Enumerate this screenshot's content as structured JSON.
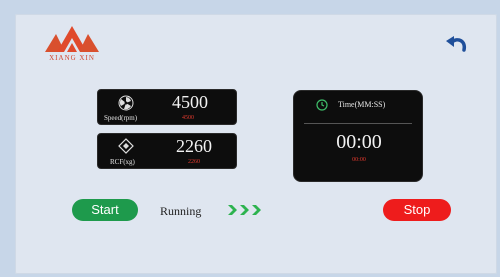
{
  "logo": {
    "brand": "XIANG XIN"
  },
  "header": {
    "back_icon": "undo-arrow-icon"
  },
  "panels": {
    "speed": {
      "label": "Speed(rpm)",
      "value": "4500",
      "setpoint": "4500",
      "icon": "fan-icon"
    },
    "rcf": {
      "label": "RCF(xg)",
      "value": "2260",
      "setpoint": "2260",
      "icon": "rcf-diamond-icon"
    },
    "time": {
      "label": "Time(MM:SS)",
      "value": "00:00",
      "setpoint": "00:00",
      "icon": "timer-icon"
    }
  },
  "controls": {
    "start_label": "Start",
    "stop_label": "Stop",
    "status": "Running",
    "progress_icon": "triple-chevron-icon"
  },
  "colors": {
    "accent_green": "#1e9a4c",
    "accent_red": "#ee1c1c",
    "setpoint_red": "#e33a2e",
    "panel_bg": "#0d0d0d",
    "logo_red": "#d2452e"
  }
}
